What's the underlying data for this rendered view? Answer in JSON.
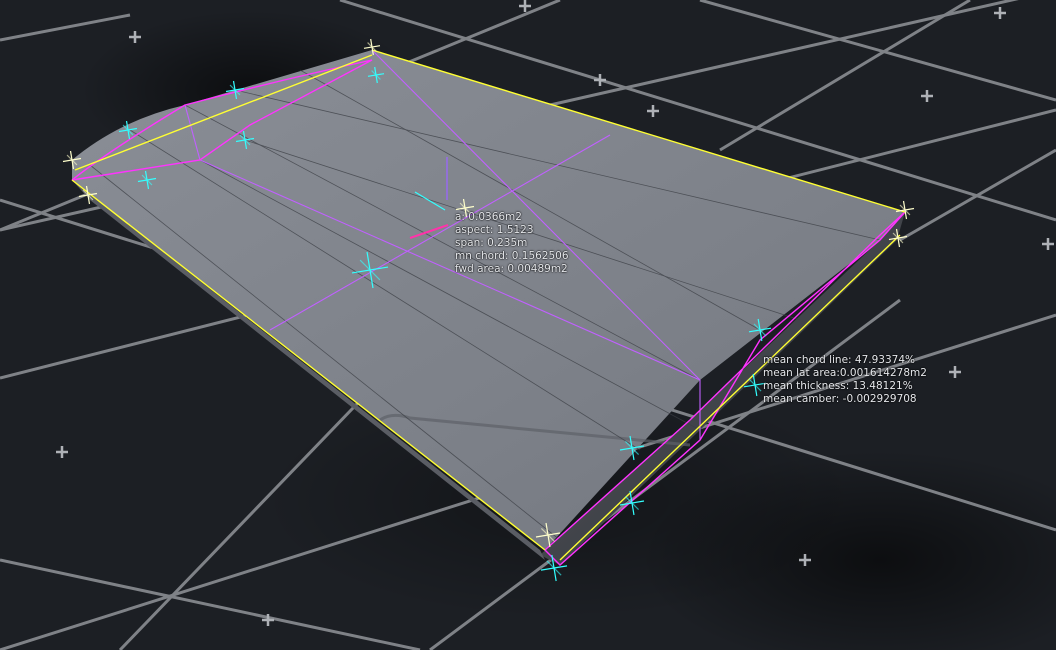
{
  "viewport": {
    "colors": {
      "background": "#1c1f24",
      "grid_line": "#8a8d92",
      "grid_cross": "#aeb1b6",
      "wing_top": "#7f838b",
      "wing_side": "#40434a",
      "outline": "#ffff33",
      "profile": "#ff33ff",
      "guide": "#c060ff",
      "gizmo": "#33ffff",
      "gizmo_point": "#ffffcc"
    }
  },
  "wing_stats": {
    "area": "a: 0.0366m2",
    "aspect": "aspect: 1.5123",
    "span": "span: 0.235m",
    "mean_chord": "mn chord: 0.1562506",
    "forward_area": "fwd area: 0.00489m2"
  },
  "section_stats": {
    "mean_chord_line": "mean chord line: 47.93374%",
    "mean_lateral_area": "mean lat area:0.001614278m2",
    "mean_thickness": "mean thickness: 13.48121%",
    "mean_camber": "mean camber: -0.002929708"
  }
}
